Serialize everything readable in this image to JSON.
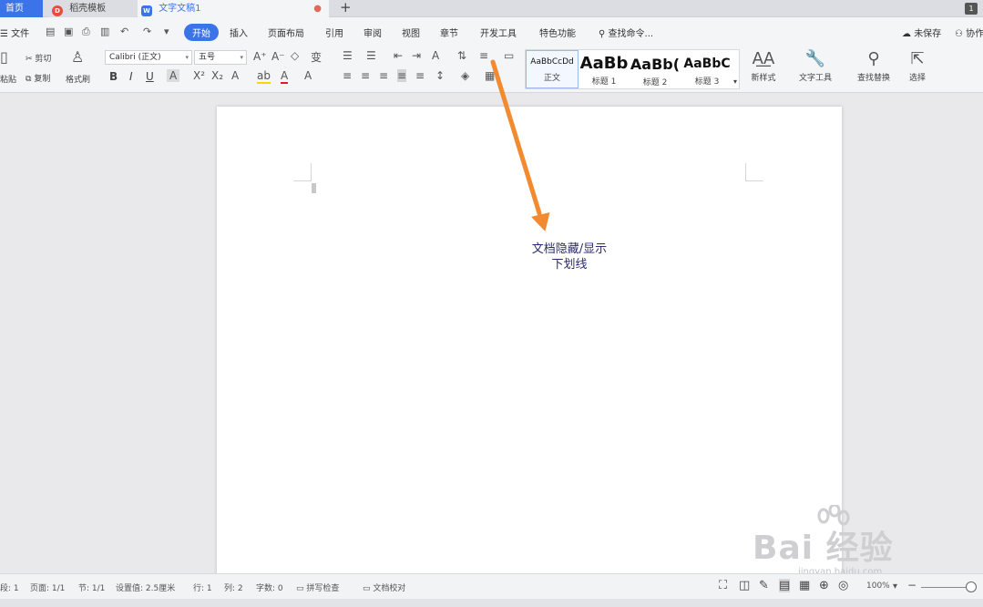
{
  "tabs": {
    "home": "首页",
    "template": "稻壳模板",
    "document": "文字文稿1",
    "close_glyph": "●",
    "add_glyph": "+",
    "window_badge": "1"
  },
  "menu": {
    "file": "文件",
    "items": [
      "开始",
      "插入",
      "页面布局",
      "引用",
      "审阅",
      "视图",
      "章节",
      "开发工具",
      "特色功能"
    ],
    "search": "查找命令...",
    "unsaved": "未保存",
    "collab": "协作"
  },
  "ribbon": {
    "paste": "粘贴",
    "cut": "剪切",
    "copy": "复制",
    "format_painter": "格式刷",
    "font_name": "Calibri (正文)",
    "font_size": "五号",
    "bold": "B",
    "italic": "I",
    "underline": "U",
    "styles": [
      {
        "sample": "AaBbCcDd",
        "caption": "正文"
      },
      {
        "sample": "AaBb",
        "caption": "标题 1"
      },
      {
        "sample": "AaBb(",
        "caption": "标题 2"
      },
      {
        "sample": "AaBbC",
        "caption": "标题 3"
      }
    ],
    "new_style": "新样式",
    "text_tools": "文字工具",
    "find_replace": "查找替换",
    "select": "选择"
  },
  "annotation": {
    "text": "文档隐藏/显示下划线",
    "arrow_color": "#f28a30"
  },
  "watermark": {
    "text": "Bai  经验",
    "url": "jingyan.baidu.com"
  },
  "status": {
    "section": "段: 1",
    "page": "页面: 1/1",
    "chapter": "节: 1/1",
    "setting": "设置值: 2.5厘米",
    "row": "行: 1",
    "col": "列: 2",
    "words": "字数: 0",
    "spell": "拼写检查",
    "proof": "文档校对",
    "zoom": "100%"
  },
  "colors": {
    "accent": "#3a74e8",
    "arrow": "#f28a30"
  }
}
